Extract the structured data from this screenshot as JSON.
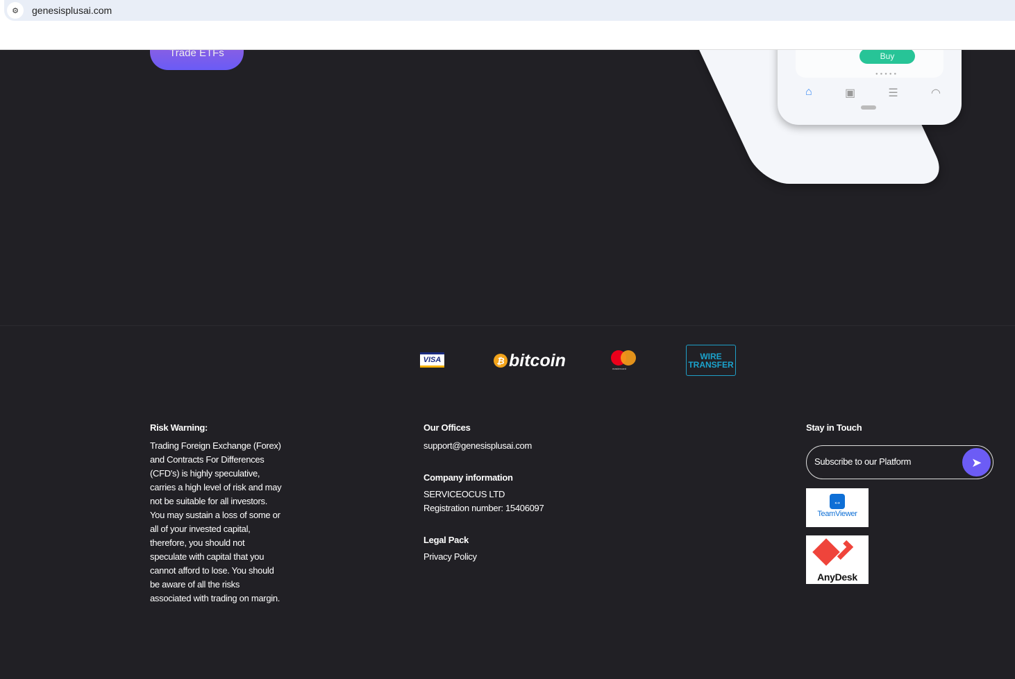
{
  "browser": {
    "url": "genesisplusai.com"
  },
  "hero": {
    "cta_label": "Trade ETFs",
    "phone_buy": "Buy"
  },
  "payments": {
    "visa": "VISA",
    "bitcoin": "bitcoin",
    "mastercard": "mastercard",
    "wire1": "WIRE",
    "wire2": "TRANSFER"
  },
  "risk": {
    "title": "Risk Warning:",
    "text": "Trading Foreign Exchange (Forex) and Contracts For Differences (CFD's) is highly speculative, carries a high level of risk and may not be suitable for all investors. You may sustain a loss of some or all of your invested capital, therefore, you should not speculate with capital that you cannot afford to lose. You should be aware of all the risks associated with trading on margin."
  },
  "offices": {
    "title": "Our Offices",
    "email": "support@genesisplusai.com",
    "company_title": "Company information",
    "company_name": "SERVICEOCUS LTD",
    "registration": "Registration number: 15406097",
    "legal_title": "Legal Pack",
    "privacy": "Privacy Policy"
  },
  "touch": {
    "title": "Stay in Touch",
    "subscribe_placeholder": "Subscribe to our Platform",
    "teamviewer": "TeamViewer",
    "anydesk": "AnyDesk"
  }
}
